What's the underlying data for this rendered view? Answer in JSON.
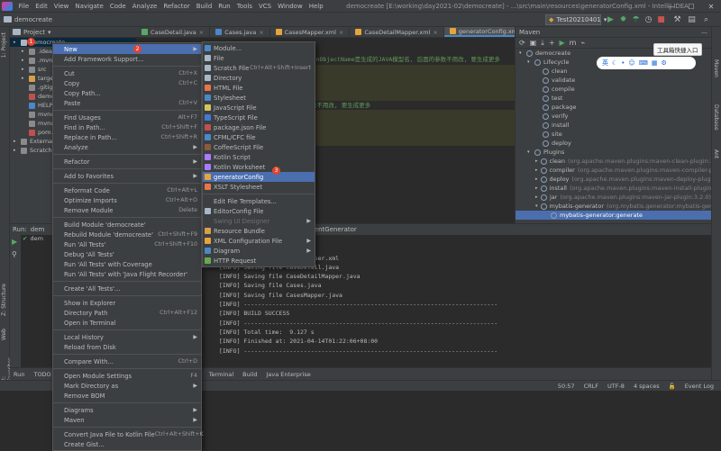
{
  "menubar": {
    "items": [
      "File",
      "Edit",
      "View",
      "Navigate",
      "Code",
      "Analyze",
      "Refactor",
      "Build",
      "Run",
      "Tools",
      "VCS",
      "Window",
      "Help"
    ],
    "window_title": "democreate [E:\\working\\day2021-02\\democreate] - ...\\src\\main\\resources\\generatorConfig.xml - IntelliJ IDEA"
  },
  "navbar": {
    "project_name": "democreate",
    "run_config": "Test20210401"
  },
  "project_panel": {
    "title": "Project",
    "rows": [
      {
        "label": "democreate",
        "sel": true
      },
      {
        "label": ".idea"
      },
      {
        "label": ".mvn"
      },
      {
        "label": "src"
      },
      {
        "label": "target"
      },
      {
        "label": ".gitign"
      },
      {
        "label": "demo"
      },
      {
        "label": "HELP.m"
      },
      {
        "label": "mvnw"
      },
      {
        "label": "mvnw."
      },
      {
        "label": "pom.x"
      },
      {
        "label": "External L"
      },
      {
        "label": "Scratches"
      }
    ]
  },
  "tabs": [
    "CaseDetail.java",
    "Cases.java",
    "CasesMapper.xml",
    "CaseDetailMapper.xml",
    "generatorConfig.xml"
  ],
  "editor": {
    "lines": [
      "",
      "",
      "",
      "              domainObjectName=\"CaseDetail\"",
      "        =\"false\" enableUpdateByExample=\"false\"",
      "        =\"false\" enableSelectByExample=\"false\"",
      "        =\"false\"></table>",
      "        domainObjectName是生成的JAVA模型名, 后面的参数不用改, 要生成更多",
      "        mainObjectName=\"Cases\"",
      "        =\"false\" enableUpdateByExample=\"false\"",
      "        =\"false\" enableSelectByExample=\"false\"",
      "        =\"false\"></table>"
    ],
    "top_comment": "domainObjectName是生成的JAVA模型名, 后面的参数不用改, 要生成更多"
  },
  "maven": {
    "title": "Maven",
    "rows": [
      {
        "label": "democreate",
        "indent": 0
      },
      {
        "label": "Lifecycle",
        "indent": 1
      },
      {
        "label": "clean",
        "indent": 2
      },
      {
        "label": "validate",
        "indent": 2
      },
      {
        "label": "compile",
        "indent": 2
      },
      {
        "label": "test",
        "indent": 2
      },
      {
        "label": "package",
        "indent": 2
      },
      {
        "label": "verify",
        "indent": 2
      },
      {
        "label": "install",
        "indent": 2
      },
      {
        "label": "site",
        "indent": 2
      },
      {
        "label": "deploy",
        "indent": 2
      },
      {
        "label": "Plugins",
        "indent": 1
      },
      {
        "label": "clean",
        "extra": "(org.apache.maven.plugins:maven-clean-plugin:3.1.0)",
        "indent": 2
      },
      {
        "label": "compiler",
        "extra": "(org.apache.maven.plugins:maven-compiler-plugin)",
        "indent": 2
      },
      {
        "label": "deploy",
        "extra": "(org.apache.maven.plugins:maven-deploy-plugin:2.8.2)",
        "indent": 2
      },
      {
        "label": "install",
        "extra": "(org.apache.maven.plugins:maven-install-plugin:2.5.2)",
        "indent": 2
      },
      {
        "label": "jar",
        "extra": "(org.apache.maven.plugins:maven-jar-plugin:3.2.0)",
        "indent": 2
      },
      {
        "label": "mybatis-generator",
        "extra": "(org.mybatis.generator:mybatis-generator)",
        "indent": 2
      },
      {
        "label": "mybatis-generator:generate",
        "indent": 3,
        "sel": true
      }
    ],
    "tooltip": "工具箱快捷入口",
    "ime_text": "英"
  },
  "run_panel": {
    "tab_label": "Run:",
    "config_label": "dem",
    "sub_tab": "ClientGenerator",
    "console": [
      "able cases",
      "apper.xml",
      "[INFO] Saving file CasesMapper.xml",
      "[INFO] Saving file CaseDetail.java",
      "[INFO] Saving file CaseDetailMapper.java",
      "[INFO] Saving file Cases.java",
      "[INFO] Saving file CasesMapper.java",
      "[INFO] ------------------------------------------------------------------------",
      "[INFO] BUILD SUCCESS",
      "[INFO] ------------------------------------------------------------------------",
      "[INFO] Total time:  9.127 s",
      "[INFO] Finished at: 2021-04-14T01:22:06+08:00",
      "[INFO] ------------------------------------------------------------------------"
    ]
  },
  "bottom_tools": [
    "Run",
    "TODO",
    "Terminal",
    "Build",
    "Java Enterprise"
  ],
  "status": {
    "pos": "50:57",
    "eol": "CRLF",
    "enc": "UTF-8",
    "indent": "4 spaces",
    "event_log": "Event Log"
  },
  "context_menu": {
    "items": [
      {
        "label": "New",
        "arrow": true,
        "hov": true
      },
      {
        "label": "Add Framework Support..."
      },
      {
        "sep": true
      },
      {
        "label": "Cut",
        "kb": "Ctrl+X"
      },
      {
        "label": "Copy",
        "kb": "Ctrl+C"
      },
      {
        "label": "Copy Path..."
      },
      {
        "label": "Paste",
        "kb": "Ctrl+V"
      },
      {
        "sep": true
      },
      {
        "label": "Find Usages",
        "kb": "Alt+F7"
      },
      {
        "label": "Find in Path...",
        "kb": "Ctrl+Shift+F"
      },
      {
        "label": "Replace in Path...",
        "kb": "Ctrl+Shift+R"
      },
      {
        "label": "Analyze",
        "arrow": true
      },
      {
        "sep": true
      },
      {
        "label": "Refactor",
        "arrow": true
      },
      {
        "sep": true
      },
      {
        "label": "Add to Favorites",
        "arrow": true
      },
      {
        "sep": true
      },
      {
        "label": "Reformat Code",
        "kb": "Ctrl+Alt+L"
      },
      {
        "label": "Optimize Imports",
        "kb": "Ctrl+Alt+O"
      },
      {
        "label": "Remove Module",
        "kb": "Delete"
      },
      {
        "sep": true
      },
      {
        "label": "Build Module 'democreate'"
      },
      {
        "label": "Rebuild Module 'democreate'",
        "kb": "Ctrl+Shift+F9"
      },
      {
        "label": "Run 'All Tests'",
        "kb": "Ctrl+Shift+F10"
      },
      {
        "label": "Debug 'All Tests'"
      },
      {
        "label": "Run 'All Tests' with Coverage"
      },
      {
        "label": "Run 'All Tests' with 'Java Flight Recorder'"
      },
      {
        "sep": true
      },
      {
        "label": "Create 'All Tests'..."
      },
      {
        "sep": true
      },
      {
        "label": "Show in Explorer"
      },
      {
        "label": "Directory Path",
        "kb": "Ctrl+Alt+F12"
      },
      {
        "label": "Open in Terminal"
      },
      {
        "sep": true
      },
      {
        "label": "Local History",
        "arrow": true
      },
      {
        "label": "Reload from Disk"
      },
      {
        "sep": true
      },
      {
        "label": "Compare With...",
        "kb": "Ctrl+D"
      },
      {
        "sep": true
      },
      {
        "label": "Open Module Settings",
        "kb": "F4"
      },
      {
        "label": "Mark Directory as",
        "arrow": true
      },
      {
        "label": "Remove BOM"
      },
      {
        "sep": true
      },
      {
        "label": "Diagrams",
        "arrow": true
      },
      {
        "label": "Maven",
        "arrow": true
      },
      {
        "sep": true
      },
      {
        "label": "Convert Java File to Kotlin File",
        "kb": "Ctrl+Alt+Shift+K"
      },
      {
        "label": "Create Gist..."
      }
    ]
  },
  "new_submenu": {
    "items": [
      {
        "label": "Module...",
        "color": "#4a88c7"
      },
      {
        "label": "File",
        "color": "#a9b7c6"
      },
      {
        "label": "Scratch File",
        "kb": "Ctrl+Alt+Shift+Insert",
        "color": "#a9b7c6"
      },
      {
        "label": "Directory",
        "color": "#a9b7c6"
      },
      {
        "label": "HTML File",
        "color": "#e8754a"
      },
      {
        "label": "Stylesheet",
        "color": "#4a88c7"
      },
      {
        "label": "JavaScript File",
        "color": "#d6c45a"
      },
      {
        "label": "TypeScript File",
        "color": "#3c7bd6"
      },
      {
        "label": "package.json File",
        "color": "#c05050"
      },
      {
        "label": "CFML/CFC file",
        "color": "#4a88c7"
      },
      {
        "label": "CoffeeScript File",
        "color": "#8a5a3c"
      },
      {
        "label": "Kotlin Script",
        "color": "#a97bff"
      },
      {
        "label": "Kotlin Worksheet",
        "color": "#a97bff"
      },
      {
        "label": "generatorConfig",
        "color": "#e8a33c",
        "hov": true
      },
      {
        "label": "XSLT Stylesheet",
        "color": "#e8754a"
      },
      {
        "sep": true
      },
      {
        "label": "Edit File Templates...",
        "color": ""
      },
      {
        "label": "EditorConfig File",
        "color": "#a9b7c6"
      },
      {
        "label": "Swing UI Designer",
        "arrow": true,
        "dis": true
      },
      {
        "label": "Resource Bundle",
        "color": "#d6a04a"
      },
      {
        "label": "XML Configuration File",
        "arrow": true,
        "color": "#e8a33c"
      },
      {
        "label": "Diagram",
        "arrow": true,
        "color": "#4a88c7"
      },
      {
        "label": "HTTP Request",
        "color": "#6aa84f"
      }
    ]
  },
  "badges": [
    "1",
    "2",
    "3"
  ]
}
